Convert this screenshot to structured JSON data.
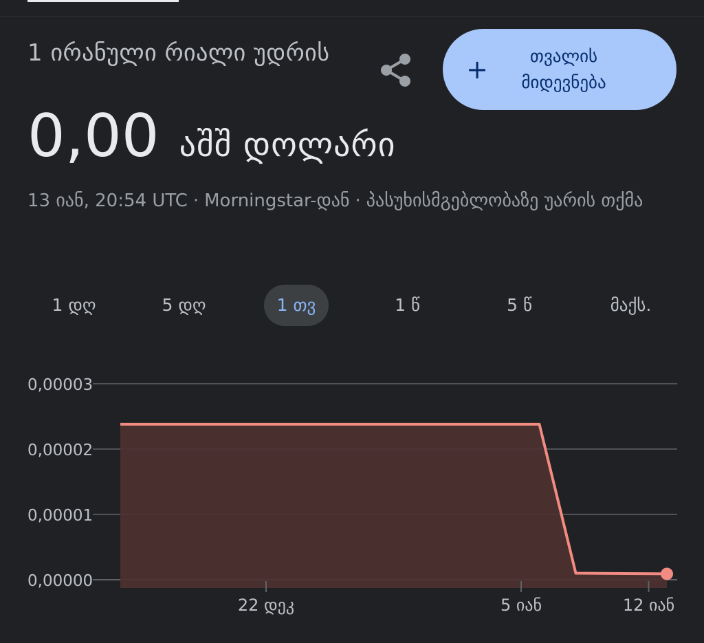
{
  "conversion": {
    "label": "1 ირანული რიალი უდრის",
    "value": "0,00",
    "currency": "აშშ დოლარი"
  },
  "actions": {
    "share_icon": "share-icon",
    "follow_icon": "plus-icon",
    "follow_label": "თვალის მიდევნება"
  },
  "meta": {
    "timestamp": "13 იან, 20:54 UTC",
    "source": "Morningstar-დან",
    "disclaimer": "პასუხისმგებლობაზე უარის თქმა",
    "separator": "·"
  },
  "tabs": [
    {
      "label": "1 დღ",
      "active": false
    },
    {
      "label": "5 დღ",
      "active": false
    },
    {
      "label": "1 თვ",
      "active": true
    },
    {
      "label": "1 წ",
      "active": false
    },
    {
      "label": "5 წ",
      "active": false
    },
    {
      "label": "მაქს.",
      "active": false
    }
  ],
  "colors": {
    "background": "#202124",
    "line": "#f28b82",
    "fill": "#4e3130",
    "grid": "#5f6368",
    "accent": "#a8c7fa"
  },
  "chart_data": {
    "type": "area",
    "x_tick_labels": [
      "22 დეკ",
      "5 იან",
      "12 იან"
    ],
    "y_tick_labels": [
      "0,00003",
      "0,00002",
      "0,00001",
      "0,00000"
    ],
    "ylim": [
      0,
      3e-05
    ],
    "grid": true,
    "series": [
      {
        "points": [
          {
            "x": "2024-12-14",
            "y": 2.38e-05
          },
          {
            "x": "2025-01-06",
            "y": 2.38e-05
          },
          {
            "x": "2025-01-08",
            "y": 1e-06
          },
          {
            "x": "2025-01-13",
            "y": 9e-07
          }
        ]
      }
    ],
    "x_ticks": [
      {
        "label": "22 დეკ",
        "date": "2024-12-22"
      },
      {
        "label": "5 იან",
        "date": "2025-01-05"
      },
      {
        "label": "12 იან",
        "date": "2025-01-12"
      }
    ]
  }
}
